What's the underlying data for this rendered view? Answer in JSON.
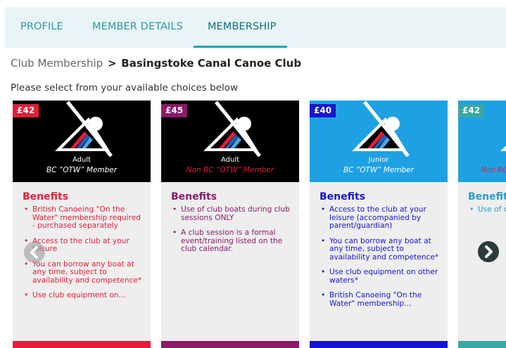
{
  "tabs": [
    {
      "label": "PROFILE",
      "active": false
    },
    {
      "label": "MEMBER DETAILS",
      "active": false
    },
    {
      "label": "MEMBERSHIP",
      "active": true
    }
  ],
  "breadcrumb": {
    "root": "Club Membership",
    "separator": ">",
    "current": "Basingstoke Canal Canoe Club"
  },
  "instructions": "Please select from your available choices below",
  "cards": [
    {
      "price": "£42",
      "line1": "Adult",
      "line2": "BC “OTW” Member",
      "benefits_title": "Benefits",
      "benefits": [
        "British Canoeing \"On the Water\" membership required - purchased separately",
        "Access to the club at your leisure",
        "You can borrow any boat at any time, subject to availability and competence*",
        "Use club equipment on..."
      ],
      "color": "#e41e37"
    },
    {
      "price": "£45",
      "line1": "Adult",
      "line2": "Non BC “OTW” Member",
      "benefits_title": "Benefits",
      "benefits": [
        "Use of club boats during club sessions ONLY",
        "A club session is a formal event/training listed on the club calendar."
      ],
      "color": "#8b1a6b"
    },
    {
      "price": "£40",
      "line1": "Junior",
      "line2": "BC “OTW” Member",
      "benefits_title": "Benefits",
      "benefits": [
        "Access to the club at your leisure (accompanied by parent/guardian)",
        "You can borrow any boat at any time, subject to availability and competence*",
        "Use club equipment on other waters*",
        "British Canoeing \"On the Water\" membership..."
      ],
      "color": "#1515d0"
    },
    {
      "price": "£42",
      "line2": "Non BC",
      "benefits_title": "Benefits",
      "benefits": [
        "Use of club se..."
      ],
      "color": "#3aa7a5"
    }
  ],
  "icons": {
    "prev": "chevron-left-icon",
    "next": "chevron-right-icon",
    "logo": "kayaker-logo-icon"
  }
}
